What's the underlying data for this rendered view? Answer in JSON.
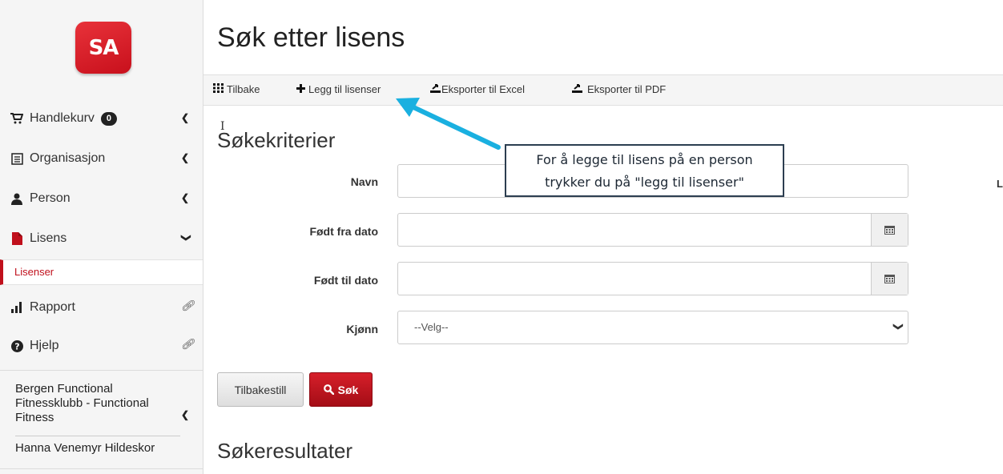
{
  "sidebar": {
    "logo_text": "SA",
    "items": [
      {
        "label": "Handlekurv",
        "badge": "0"
      },
      {
        "label": "Organisasjon"
      },
      {
        "label": "Person"
      },
      {
        "label": "Lisens"
      },
      {
        "label": "Rapport"
      },
      {
        "label": "Hjelp"
      }
    ],
    "sub_item": "Lisenser",
    "org_name": "Bergen Functional Fitnessklubb - Functional Fitness",
    "user_name": "Hanna Venemyr Hildeskor"
  },
  "page": {
    "title": "Søk etter lisens"
  },
  "toolbar": {
    "back_label": "Tilbake",
    "add_label": "Legg til lisenser",
    "excel_label": "Eksporter til Excel",
    "pdf_label": "Eksporter til PDF"
  },
  "search": {
    "heading": "Søkekriterier",
    "name_label": "Navn",
    "born_from_label": "Født fra dato",
    "born_to_label": "Født til dato",
    "gender_label": "Kjønn",
    "gender_selected": "--Velg--",
    "right_label_partial": "L",
    "reset_button": "Tilbakestill",
    "search_button": "Søk"
  },
  "results": {
    "heading": "Søkeresultater"
  },
  "annotation": {
    "line1": "For å legge til lisens på en person",
    "line2": "trykker du på \"legg til lisenser\"",
    "color": "#1ab0e0"
  },
  "colors": {
    "brand_red": "#c8101c",
    "accent_blue": "#1ab0e0"
  }
}
